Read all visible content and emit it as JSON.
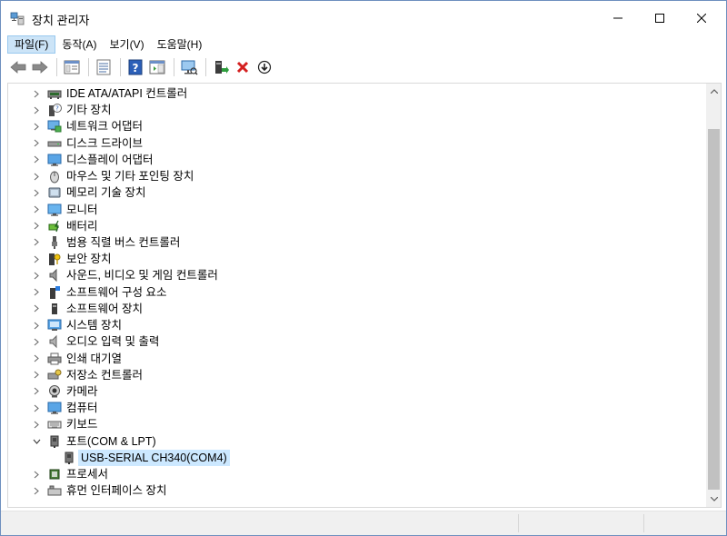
{
  "window": {
    "title": "장치 관리자"
  },
  "menu": [
    {
      "label": "파일(F)",
      "active": true
    },
    {
      "label": "동작(A)",
      "active": false
    },
    {
      "label": "보기(V)",
      "active": false
    },
    {
      "label": "도움말(H)",
      "active": false
    }
  ],
  "toolbar": [
    "back-icon",
    "forward-icon",
    "properties-pane-icon",
    "list-view-icon",
    "help-icon",
    "action-pane-icon",
    "scan-hardware-icon",
    "update-driver-icon",
    "uninstall-device-icon",
    "download-icon"
  ],
  "tree": {
    "categories": [
      {
        "label": "IDE ATA/ATAPI 컨트롤러",
        "icon": "ide-controller-icon"
      },
      {
        "label": "기타 장치",
        "icon": "unknown-device-icon"
      },
      {
        "label": "네트워크 어댑터",
        "icon": "network-adapter-icon"
      },
      {
        "label": "디스크 드라이브",
        "icon": "disk-drive-icon"
      },
      {
        "label": "디스플레이 어댑터",
        "icon": "display-adapter-icon"
      },
      {
        "label": "마우스 및 기타 포인팅 장치",
        "icon": "mouse-icon"
      },
      {
        "label": "메모리 기술 장치",
        "icon": "memory-device-icon"
      },
      {
        "label": "모니터",
        "icon": "monitor-icon"
      },
      {
        "label": "배터리",
        "icon": "battery-icon"
      },
      {
        "label": "범용 직렬 버스 컨트롤러",
        "icon": "usb-controller-icon"
      },
      {
        "label": "보안 장치",
        "icon": "security-device-icon"
      },
      {
        "label": "사운드, 비디오 및 게임 컨트롤러",
        "icon": "sound-icon"
      },
      {
        "label": "소프트웨어 구성 요소",
        "icon": "software-component-icon"
      },
      {
        "label": "소프트웨어 장치",
        "icon": "software-device-icon"
      },
      {
        "label": "시스템 장치",
        "icon": "system-device-icon"
      },
      {
        "label": "오디오 입력 및 출력",
        "icon": "audio-io-icon"
      },
      {
        "label": "인쇄 대기열",
        "icon": "print-queue-icon"
      },
      {
        "label": "저장소 컨트롤러",
        "icon": "storage-controller-icon"
      },
      {
        "label": "카메라",
        "icon": "camera-icon"
      },
      {
        "label": "컴퓨터",
        "icon": "computer-icon"
      },
      {
        "label": "키보드",
        "icon": "keyboard-icon"
      },
      {
        "label": "포트(COM & LPT)",
        "icon": "port-icon",
        "expanded": true,
        "children": [
          {
            "label": "USB-SERIAL CH340(COM4)",
            "icon": "port-device-icon",
            "selected": true
          }
        ]
      },
      {
        "label": "프로세서",
        "icon": "processor-icon"
      },
      {
        "label": "휴먼 인터페이스 장치",
        "icon": "hid-icon"
      }
    ]
  },
  "colors": {
    "selection": "#cce8ff",
    "menu_active": "#cce4f7",
    "scrollbar_thumb": "#c1c1c1"
  }
}
